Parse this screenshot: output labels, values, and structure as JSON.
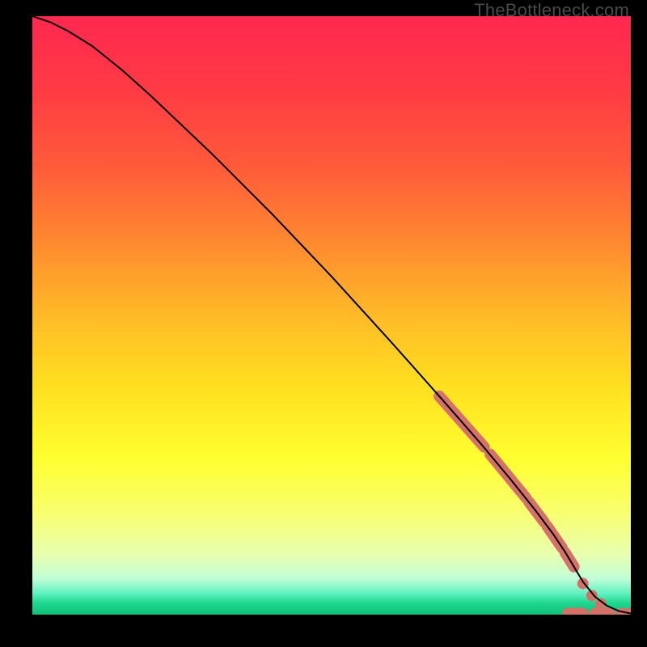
{
  "watermark": "TheBottleneck.com",
  "chart_data": {
    "type": "line",
    "title": "",
    "xlabel": "",
    "ylabel": "",
    "xlim": [
      0,
      100
    ],
    "ylim": [
      0,
      100
    ],
    "grid": false,
    "legend": false,
    "gradient_stops": [
      {
        "offset": 0.0,
        "color": "#ff2850"
      },
      {
        "offset": 0.12,
        "color": "#ff3a44"
      },
      {
        "offset": 0.25,
        "color": "#ff5a3a"
      },
      {
        "offset": 0.38,
        "color": "#ff8a30"
      },
      {
        "offset": 0.5,
        "color": "#ffba28"
      },
      {
        "offset": 0.62,
        "color": "#ffe020"
      },
      {
        "offset": 0.74,
        "color": "#ffff30"
      },
      {
        "offset": 0.83,
        "color": "#f8ff70"
      },
      {
        "offset": 0.9,
        "color": "#e8ffb0"
      },
      {
        "offset": 0.94,
        "color": "#c0ffd8"
      },
      {
        "offset": 0.965,
        "color": "#60f0c0"
      },
      {
        "offset": 0.98,
        "color": "#20d890"
      },
      {
        "offset": 1.0,
        "color": "#10c078"
      }
    ],
    "series": [
      {
        "name": "curve",
        "color": "#000000",
        "width": 2,
        "x": [
          0,
          3,
          6,
          10,
          15,
          20,
          30,
          40,
          50,
          60,
          68,
          75,
          80,
          84,
          87,
          89,
          90.5,
          92,
          94,
          96,
          98,
          100
        ],
        "y": [
          100,
          99,
          97.5,
          95,
          91,
          86.5,
          77,
          67,
          56.5,
          45.5,
          36.5,
          28.5,
          22.5,
          17.5,
          13.5,
          10.5,
          8,
          5.5,
          3,
          1.5,
          0.6,
          0.2
        ]
      }
    ],
    "highlight": {
      "color": "#d6716a",
      "band_width": 14,
      "segments": [
        {
          "x1": 68,
          "y1": 36.5,
          "x2": 75.5,
          "y2": 28
        },
        {
          "x1": 76.5,
          "y1": 26.8,
          "x2": 82.5,
          "y2": 19.5
        },
        {
          "x1": 83,
          "y1": 18.8,
          "x2": 85.5,
          "y2": 15.5
        },
        {
          "x1": 86,
          "y1": 14.8,
          "x2": 88.5,
          "y2": 11.2
        },
        {
          "x1": 89,
          "y1": 10.4,
          "x2": 90.5,
          "y2": 8.0
        }
      ],
      "dots": [
        {
          "x": 92.0,
          "y": 5.2
        },
        {
          "x": 93.5,
          "y": 3.2
        },
        {
          "x": 95.0,
          "y": 1.8
        }
      ],
      "flat_segments": [
        {
          "x1": 89.5,
          "y1": 0.2,
          "x2": 92.0,
          "y2": 0.2
        },
        {
          "x1": 94.0,
          "y1": 0.2,
          "x2": 96.5,
          "y2": 0.2
        }
      ],
      "flat_dots": [
        {
          "x": 98.5,
          "y": 0.2
        },
        {
          "x": 99.8,
          "y": 0.2
        }
      ]
    }
  }
}
